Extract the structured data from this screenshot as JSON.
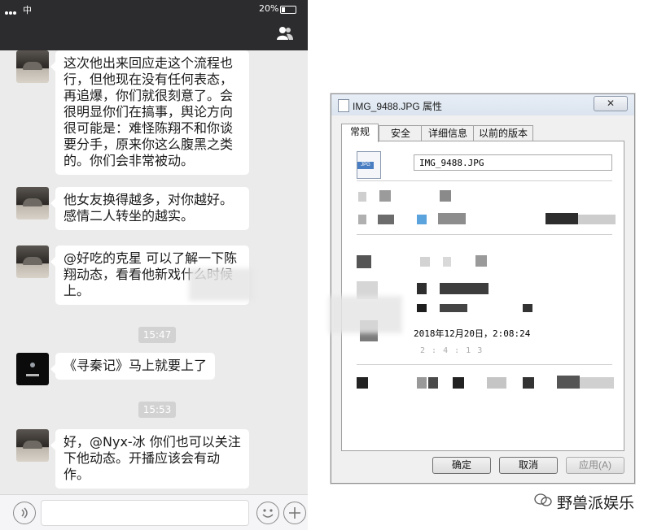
{
  "status_bar": {
    "carrier": "中",
    "battery": "20%"
  },
  "chat": {
    "messages": [
      {
        "type": "text",
        "text": "这次他出来回应走这个流程也\n行，但他现在没有任何表态，\n再追爆，你们就很刻意了。会\n很明显你们在搞事，舆论方向\n很可能是：难怪陈翔不和你谈\n要分手，原来你这么腹黑之类\n的。你们会非常被动。"
      },
      {
        "type": "text",
        "text": "他女友换得越多，对你越好。\n感情二人转坐的越实。"
      },
      {
        "type": "text",
        "text": "@好吃的克星 可以了解一下陈\n翔动态，看看他新戏什么时候\n上。"
      },
      {
        "type": "time",
        "text": "15:47"
      },
      {
        "type": "text",
        "text": "《寻秦记》马上就要上了"
      },
      {
        "type": "time",
        "text": "15:53"
      },
      {
        "type": "text",
        "text": "好，@Nyx-冰 你们也可以关注\n下他动态。开播应该会有动\n作。"
      }
    ]
  },
  "dialog": {
    "title": "IMG_9488.JPG 属性",
    "close_label": "✕",
    "tabs": [
      "常规",
      "安全",
      "详细信息",
      "以前的版本"
    ],
    "active_tab": "常规",
    "file_type_tag": "JPG",
    "filename": "IMG_9488.JPG",
    "date_line": "2018年12月20日，2:08:24",
    "faint_line": "2 : 4 : 1 3",
    "buttons": {
      "ok": "确定",
      "cancel": "取消",
      "apply": "应用(A)"
    }
  },
  "brand": {
    "name": "野兽派娱乐"
  },
  "colors": {
    "chat_bg": "#ebebeb",
    "bubble": "#ffffff",
    "navbar": "#2c2c2e",
    "dialog_bg": "#f0f0f0"
  }
}
